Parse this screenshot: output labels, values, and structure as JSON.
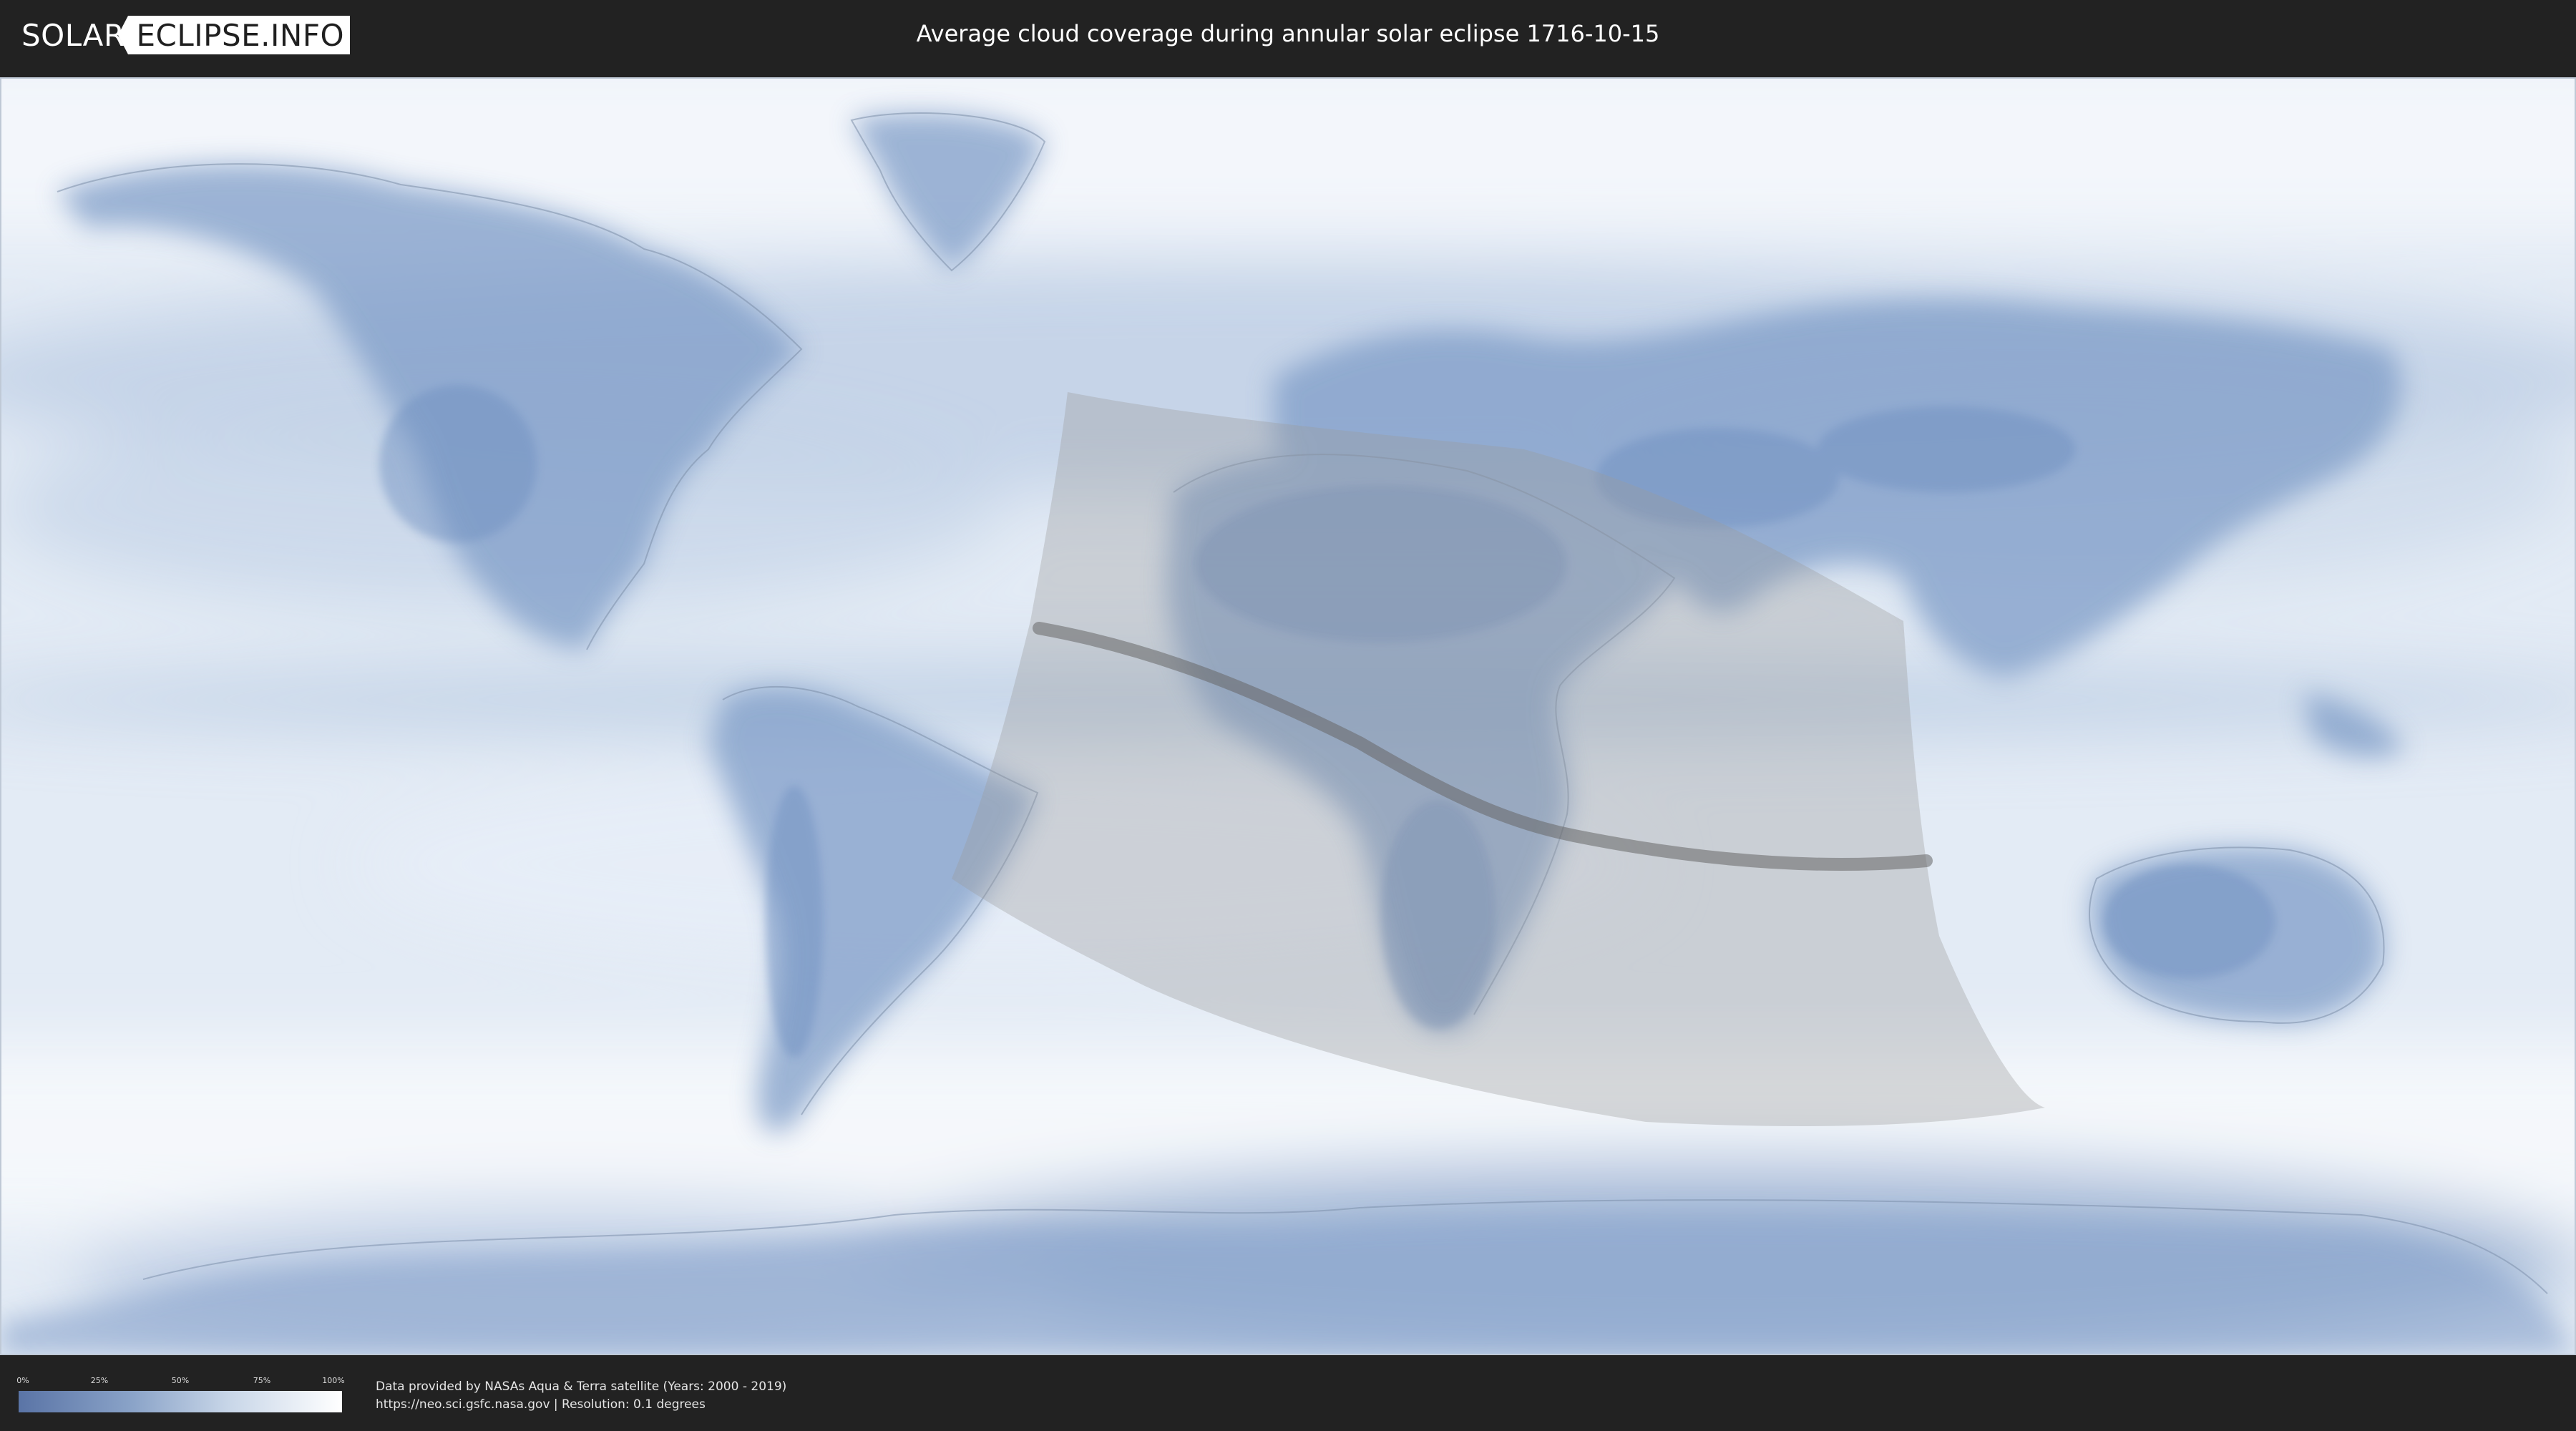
{
  "header": {
    "logo_solar": "SOLAR",
    "logo_eclipse": "ECLIPSE.INFO",
    "title": "Average cloud coverage during annular solar eclipse 1716-10-15"
  },
  "legend": {
    "ticks": [
      "0%",
      "25%",
      "50%",
      "75%",
      "100%"
    ],
    "colors": {
      "low": "#5a74a6",
      "high": "#ffffff"
    }
  },
  "credits": {
    "line1": "Data provided by NASAs Aqua & Terra satellite (Years: 2000 - 2019)",
    "line2": "https://neo.sci.gsfc.nasa.gov | Resolution: 0.1 degrees"
  },
  "map": {
    "projection": "equirectangular",
    "eclipse_type": "annular",
    "date": "1716-10-15"
  }
}
